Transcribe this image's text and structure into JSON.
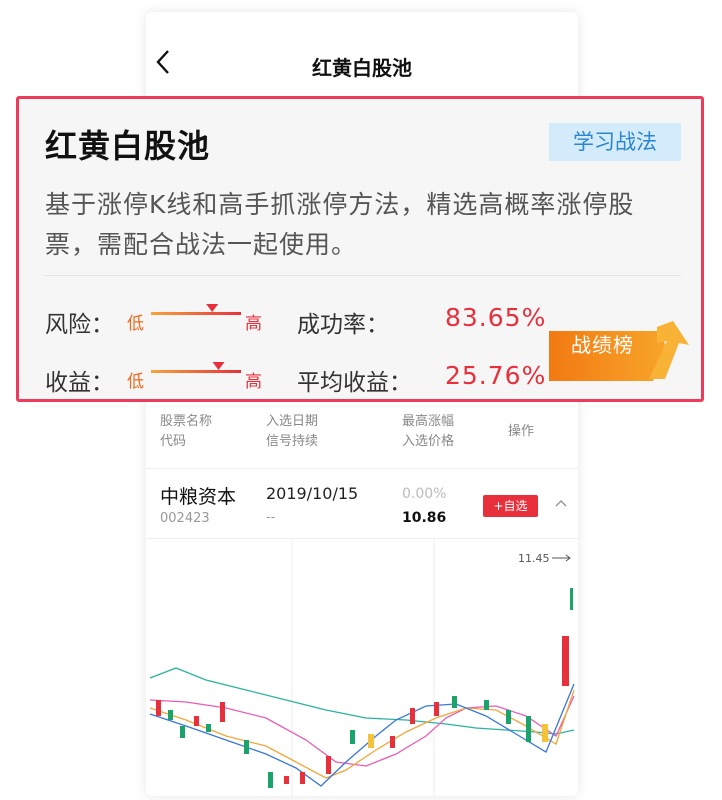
{
  "navbar": {
    "title": "红黄白股池"
  },
  "card": {
    "title": "红黄白股池",
    "learn_button": "学习战法",
    "description": "基于涨停K线和高手抓涨停方法，精选高概率涨停股票，需配合战法一起使用。",
    "risk_label": "风险：",
    "return_label": "收益：",
    "low": "低",
    "high": "高",
    "risk_level": 0.68,
    "return_level": 0.75,
    "success_rate_label": "成功率：",
    "success_rate_value": "83.65%",
    "avg_return_label": "平均收益：",
    "avg_return_value": "25.76%",
    "rank_button": "战绩榜"
  },
  "table": {
    "headers": {
      "name": "股票名称",
      "code": "代码",
      "date": "入选日期",
      "duration": "信号持续",
      "max_rise": "最高涨幅",
      "entry_price": "入选价格",
      "action": "操作"
    },
    "rows": [
      {
        "name": "中粮资本",
        "code": "002423",
        "date": "2019/10/15",
        "duration": "--",
        "max_rise": "0.00%",
        "entry_price": "10.86",
        "add_button": "+自选"
      }
    ]
  },
  "chart": {
    "max_price_label": "11.45"
  },
  "colors": {
    "accent_red": "#e8303d",
    "highlight_border": "#ee3b5b",
    "learn_bg": "#d4ebfb",
    "learn_text": "#2a86cf",
    "rank_orange": "#f28a1a",
    "up_candle": "#e8303d",
    "down_candle": "#1aa36b"
  },
  "icons": {
    "back": "chevron-left-icon",
    "collapse": "chevron-up-icon",
    "rank": "arrow-up-icon"
  }
}
